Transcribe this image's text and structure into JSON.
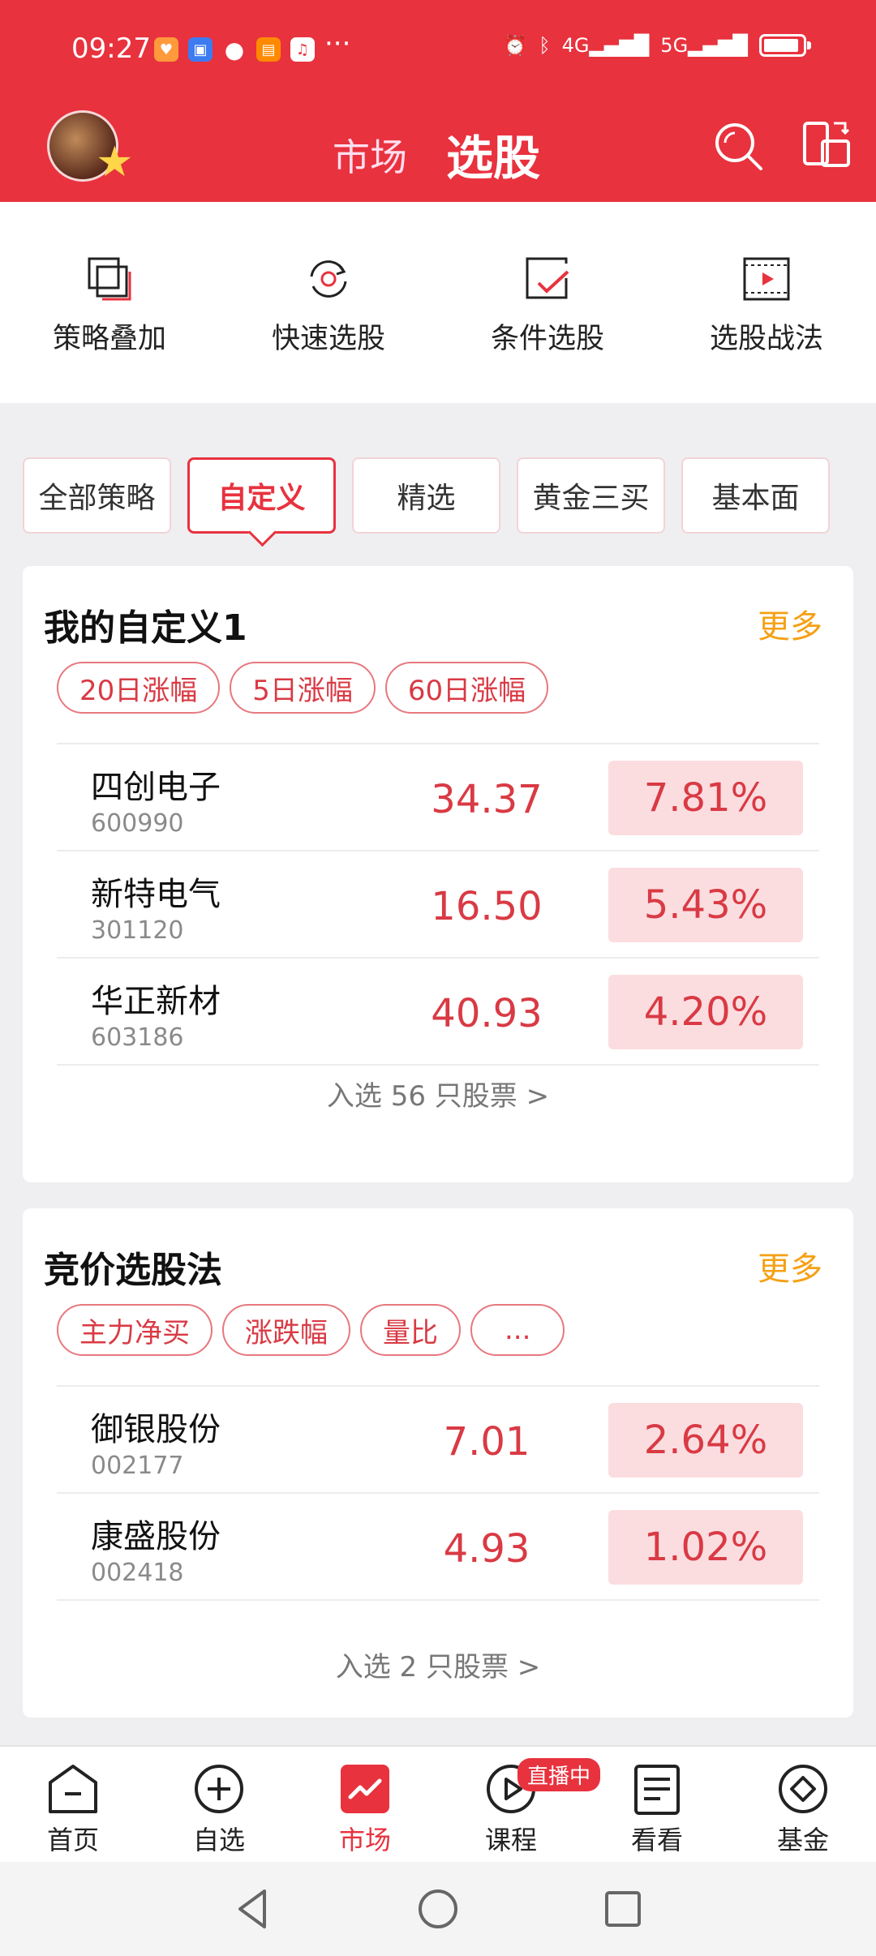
{
  "status_bar": {
    "time": "09:27",
    "more": "···",
    "net1": "4G",
    "net2": "5G"
  },
  "header": {
    "tab_market": "市场",
    "tab_select": "选股"
  },
  "tools": [
    {
      "label": "策略叠加",
      "icon": "stack-icon"
    },
    {
      "label": "快速选股",
      "icon": "refresh-icon"
    },
    {
      "label": "条件选股",
      "icon": "check-square-icon"
    },
    {
      "label": "选股战法",
      "icon": "video-icon"
    }
  ],
  "chips": [
    {
      "label": "全部策略",
      "active": false
    },
    {
      "label": "自定义",
      "active": true
    },
    {
      "label": "精选",
      "active": false
    },
    {
      "label": "黄金三买",
      "active": false
    },
    {
      "label": "基本面",
      "active": false
    }
  ],
  "card1": {
    "title": "我的自定义1",
    "more": "更多",
    "tags": [
      "20日涨幅",
      "5日涨幅",
      "60日涨幅"
    ],
    "rows": [
      {
        "name": "四创电子",
        "code": "600990",
        "price": "34.37",
        "pct": "7.81%"
      },
      {
        "name": "新特电气",
        "code": "301120",
        "price": "16.50",
        "pct": "5.43%"
      },
      {
        "name": "华正新材",
        "code": "603186",
        "price": "40.93",
        "pct": "4.20%"
      }
    ],
    "footer": "入选 56 只股票 >"
  },
  "card2": {
    "title": "竞价选股法",
    "more": "更多",
    "tags": [
      "主力净买",
      "涨跌幅",
      "量比",
      "..."
    ],
    "rows": [
      {
        "name": "御银股份",
        "code": "002177",
        "price": "7.01",
        "pct": "2.64%"
      },
      {
        "name": "康盛股份",
        "code": "002418",
        "price": "4.93",
        "pct": "1.02%"
      }
    ],
    "footer": "入选 2 只股票 >"
  },
  "bottom_nav": [
    {
      "label": "首页",
      "icon": "home-icon",
      "active": false
    },
    {
      "label": "自选",
      "icon": "plus-circle-icon",
      "active": false
    },
    {
      "label": "市场",
      "icon": "market-icon",
      "active": true
    },
    {
      "label": "课程",
      "icon": "play-circle-icon",
      "active": false,
      "badge": "直播中"
    },
    {
      "label": "看看",
      "icon": "document-icon",
      "active": false
    },
    {
      "label": "基金",
      "icon": "diamond-icon",
      "active": false
    }
  ],
  "colors": {
    "brand_red": "#e8323e",
    "accent_orange": "#f5a015",
    "up_red": "#d93a44",
    "pct_bg": "#fbdde0"
  }
}
